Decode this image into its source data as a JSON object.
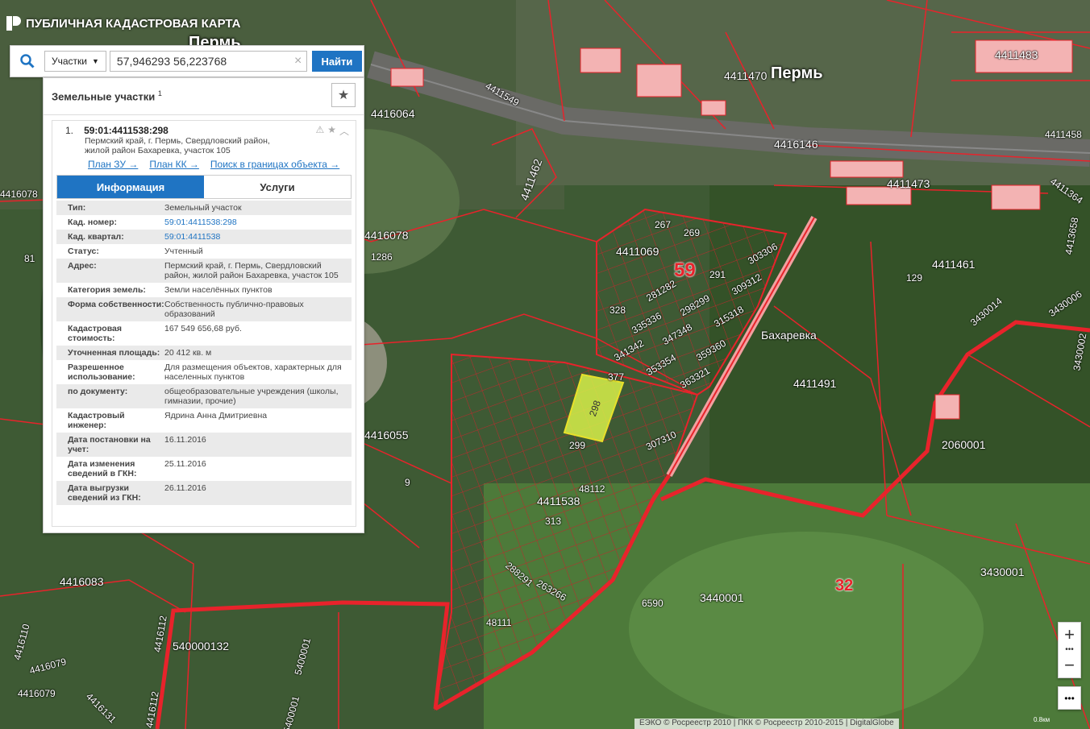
{
  "app": {
    "title": "ПУБЛИЧНАЯ КАДАСТРОВАЯ КАРТА"
  },
  "search": {
    "type_label": "Участки",
    "query": "57,946293 56,223768",
    "clear_symbol": "×",
    "find_label": "Найти"
  },
  "results": {
    "title": "Земельные участки",
    "count": "1",
    "item": {
      "index": "1.",
      "cad_number": "59:01:4411538:298",
      "address_lines": [
        "Пермский край, г. Пермь, Свердловский район,",
        "жилой район Бахаревка, участок 105"
      ],
      "links": [
        "План ЗУ →",
        "План КК →",
        "Поиск в границах объекта →"
      ],
      "tabs": [
        "Информация",
        "Услуги"
      ],
      "info": [
        {
          "key": "Тип:",
          "val": "Земельный участок"
        },
        {
          "key": "Кад. номер:",
          "val": "59:01:4411538:298"
        },
        {
          "key": "Кад. квартал:",
          "val": "59:01:4411538"
        },
        {
          "key": "Статус:",
          "val": "Учтенный"
        },
        {
          "key": "Адрес:",
          "val": "Пермский край, г. Пермь, Свердловский район, жилой район Бахаревка, участок 105"
        },
        {
          "key": "Категория земель:",
          "val": "Земли населённых пунктов"
        },
        {
          "key": "Форма собственности:",
          "val": "Собственность публично-правовых образований"
        },
        {
          "key": "Кадастровая стоимость:",
          "val": "167 549 656,68 руб."
        },
        {
          "key": "Уточненная площадь:",
          "val": "20 412 кв. м"
        },
        {
          "key": "Разрешенное использование:",
          "val": "Для размещения объектов, характерных для населенных пунктов"
        },
        {
          "key": "по документу:",
          "val": "общеобразовательные учреждения (школы, гимназии, прочие)"
        },
        {
          "key": "Кадастровый инженер:",
          "val": "Ядрина Анна Дмитриевна"
        },
        {
          "key": "Дата постановки на учет:",
          "val": "16.11.2016"
        },
        {
          "key": "Дата изменения сведений в ГКН:",
          "val": "25.11.2016"
        },
        {
          "key": "Дата выгрузки сведений из ГКН:",
          "val": "26.11.2016"
        }
      ]
    }
  },
  "map": {
    "city": "Пермь",
    "city_top": "Пермь",
    "village": "Бахаревка",
    "block_59": "59",
    "block_32": "32",
    "labels": [
      "4411549",
      "4416064",
      "4416146",
      "4411470",
      "4411483",
      "4416078",
      "4416078",
      "4411462",
      "4411069",
      "4411473",
      "4411461",
      "4411491",
      "4411538",
      "4416055",
      "4416083",
      "2060001",
      "3430001",
      "3440001",
      "3430014",
      "540000132",
      "4416079",
      "4416079",
      "4416110",
      "4416131",
      "4416112",
      "4416112",
      "4411364",
      "4411458",
      "3430006",
      "3430002",
      "4413658",
      "5400001",
      "5400001",
      "6590",
      "1286",
      "81",
      "9",
      "48111",
      "48112",
      "299",
      "377",
      "298",
      "307310",
      "309312",
      "303306",
      "298299",
      "281282",
      "347348",
      "335336",
      "315318",
      "359360",
      "353354",
      "341342",
      "363321",
      "313",
      "288291",
      "263266",
      "328",
      "267",
      "269",
      "291",
      "129"
    ]
  },
  "controls": {
    "zoom_in": "+",
    "zoom_out": "−",
    "more": "•••"
  },
  "attribution": "ЕЭКО © Росреестр 2010 | ПКК © Росреестр 2010-2015 | DigitalGlobe",
  "scale": "0.8км",
  "colors": {
    "accent": "#1f74c3",
    "boundary": "#e8232b",
    "selected_parcel": "#d7f04a"
  }
}
